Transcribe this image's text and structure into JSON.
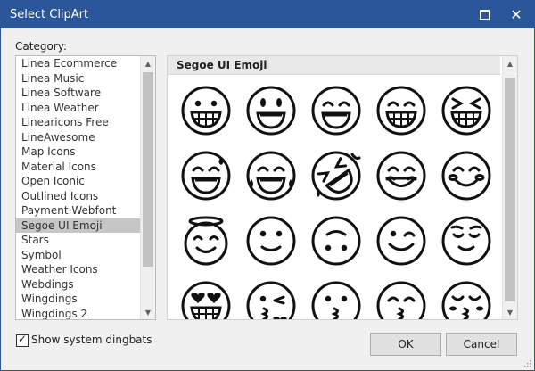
{
  "window": {
    "title": "Select ClipArt"
  },
  "category_label": "Category:",
  "categories": [
    "Linea Ecommerce",
    "Linea Music",
    "Linea Software",
    "Linea Weather",
    "Linearicons Free",
    "LineAwesome",
    "Map Icons",
    "Material Icons",
    "Open Iconic",
    "Outlined Icons",
    "Payment Webfont",
    "Segoe UI Emoji",
    "Stars",
    "Symbol",
    "Weather Icons",
    "Webdings",
    "Wingdings",
    "Wingdings 2"
  ],
  "selected_category": "Segoe UI Emoji",
  "gallery": {
    "title": "Segoe UI Emoji",
    "icons": [
      "grinning-face",
      "smiley-face",
      "smiling-eyes-face",
      "grin-face",
      "laughing-squint-face",
      "sweat-smile-face",
      "tears-of-joy-face",
      "rofl-face",
      "smiling-closed-eyes-face",
      "smiling-blush-face",
      "halo-face",
      "slightly-smiling-face",
      "upside-down-face",
      "winking-face",
      "relieved-face",
      "heart-eyes-face",
      "kissing-heart-face",
      "kissing-face",
      "kissing-smiling-eyes-face",
      "kissing-closed-eyes-face"
    ]
  },
  "show_system_dingbats": {
    "label": "Show system dingbats",
    "checked": true
  },
  "buttons": {
    "ok": "OK",
    "cancel": "Cancel"
  },
  "colors": {
    "titlebar": "#2b579a",
    "selection": "#c6c6c6"
  }
}
